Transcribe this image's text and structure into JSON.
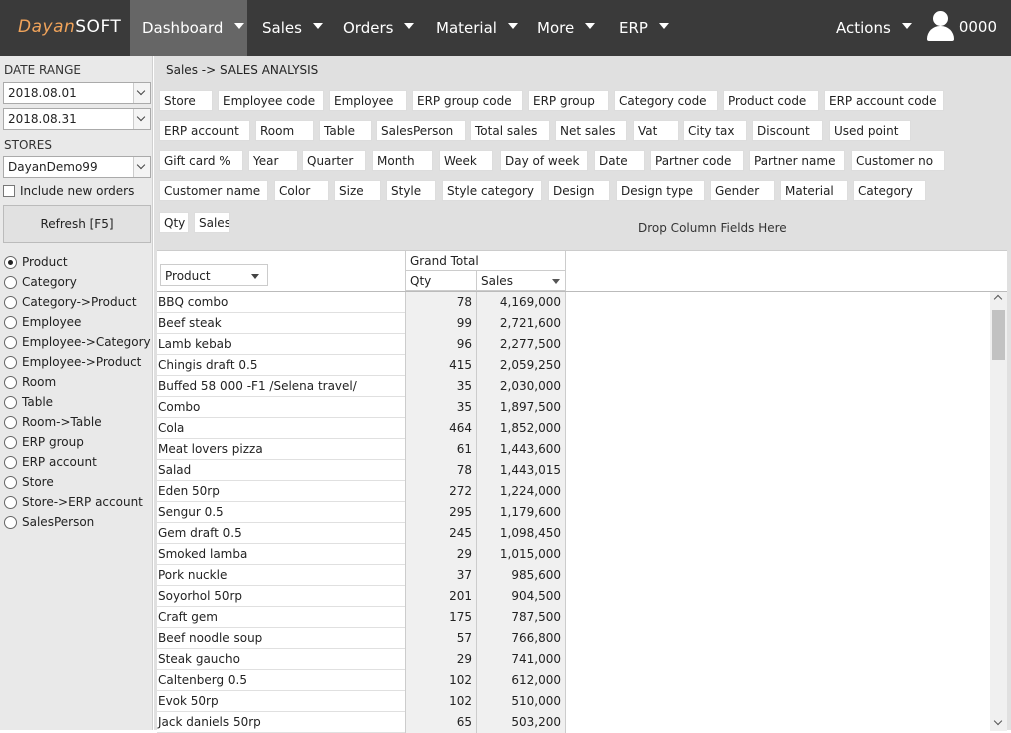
{
  "header": {
    "logo_part1": "Dayan",
    "logo_part2": "SOFT",
    "nav": [
      {
        "label": "Dashboard"
      },
      {
        "label": "Sales"
      },
      {
        "label": "Orders"
      },
      {
        "label": "Material"
      },
      {
        "label": "More"
      },
      {
        "label": "ERP"
      }
    ],
    "actions_label": "Actions",
    "user_label": "0000"
  },
  "sidebar": {
    "date_range_label": "DATE RANGE",
    "date_from": "2018.08.01",
    "date_to": "2018.08.31",
    "stores_label": "STORES",
    "store_value": "DayanDemo99",
    "include_new_orders": "Include new orders",
    "refresh_label": "Refresh [F5]",
    "group_options": [
      "Product",
      "Category",
      "Category->Product",
      "Employee",
      "Employee->Category",
      "Employee->Product",
      "Room",
      "Table",
      "Room->Table",
      "ERP group",
      "ERP account",
      "Store",
      "Store->ERP account",
      "SalesPerson"
    ],
    "selected_option": "Product"
  },
  "main": {
    "breadcrumb": "Sales -> SALES ANALYSIS",
    "field_rows": [
      [
        "Store",
        "Employee code",
        "Employee",
        "ERP group code",
        "ERP group",
        "Category code",
        "Product code",
        "ERP account code"
      ],
      [
        "ERP account",
        "Room",
        "Table",
        "SalesPerson",
        "Total sales",
        "Net sales",
        "Vat",
        "City tax",
        "Discount",
        "Used point"
      ],
      [
        "Gift card %",
        "Year",
        "Quarter",
        "Month",
        "Week",
        "Day of week",
        "Date",
        "Partner code",
        "Partner name",
        "Customer no"
      ],
      [
        "Customer name",
        "Color",
        "Size",
        "Style",
        "Style category",
        "Design",
        "Design type",
        "Gender",
        "Material",
        "Category"
      ],
      [
        "Qty",
        "Sales"
      ]
    ],
    "drop_column_text": "Drop Column Fields Here"
  },
  "table": {
    "row_field_label": "Product",
    "grand_total_label": "Grand Total",
    "col_qty": "Qty",
    "col_sales": "Sales",
    "rows": [
      [
        "BBQ combo",
        "78",
        "4,169,000"
      ],
      [
        "Beef steak",
        "99",
        "2,721,600"
      ],
      [
        "Lamb kebab",
        "96",
        "2,277,500"
      ],
      [
        "Chingis draft 0.5",
        "415",
        "2,059,250"
      ],
      [
        "Buffed 58 000 -F1 /Selena travel/",
        "35",
        "2,030,000"
      ],
      [
        "Combo",
        "35",
        "1,897,500"
      ],
      [
        "Cola",
        "464",
        "1,852,000"
      ],
      [
        "Meat lovers pizza",
        "61",
        "1,443,600"
      ],
      [
        "Salad",
        "78",
        "1,443,015"
      ],
      [
        "Eden 50rp",
        "272",
        "1,224,000"
      ],
      [
        "Sengur 0.5",
        "295",
        "1,179,600"
      ],
      [
        "Gem draft 0.5",
        "245",
        "1,098,450"
      ],
      [
        "Smoked lamba",
        "29",
        "1,015,000"
      ],
      [
        "Pork nuckle",
        "37",
        "985,600"
      ],
      [
        "Soyorhol 50rp",
        "201",
        "904,500"
      ],
      [
        "Craft gem",
        "175",
        "787,500"
      ],
      [
        "Beef noodle soup",
        "57",
        "766,800"
      ],
      [
        "Steak gaucho",
        "29",
        "741,000"
      ],
      [
        "Caltenberg 0.5",
        "102",
        "612,000"
      ],
      [
        "Evok 50rp",
        "102",
        "510,000"
      ],
      [
        "Jack daniels 50rp",
        "65",
        "503,200"
      ]
    ]
  },
  "colors": {
    "topbar": "#3a3a3a",
    "nav_active": "#666666",
    "logo_accent": "#f0a35a",
    "sidebar_bg": "#e9e9e9",
    "main_bg": "#e0e0e0"
  }
}
